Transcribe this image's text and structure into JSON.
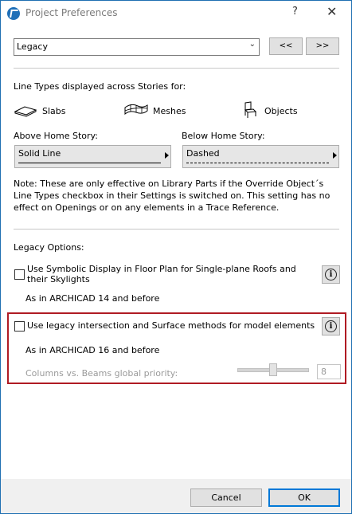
{
  "window": {
    "title": "Project Preferences",
    "help_glyph": "?",
    "close_glyph": "✕"
  },
  "prefs": {
    "selected": "Legacy",
    "prev_label": "<<",
    "next_label": ">>"
  },
  "linetypes": {
    "heading": "Line Types displayed across Stories for:",
    "items": [
      {
        "icon": "slab-icon",
        "label": "Slabs"
      },
      {
        "icon": "mesh-icon",
        "label": "Meshes"
      },
      {
        "icon": "chair-icon",
        "label": "Objects"
      }
    ],
    "above_label": "Above Home Story:",
    "above_value": "Solid Line",
    "below_label": "Below Home Story:",
    "below_value": "Dashed",
    "note": "Note: These are only effective on Library Parts if the Override Object´s Line Types checkbox in their Settings is switched on. This setting has no effect on Openings or on any elements in a Trace Reference."
  },
  "legacy": {
    "heading": "Legacy Options:",
    "opt1_label": "Use Symbolic Display in Floor Plan for Single-plane Roofs and their Skylights",
    "opt1_sub": "As in ARCHICAD 14 and before",
    "opt2_label": "Use legacy intersection and Surface methods for model elements",
    "opt2_sub": "As in ARCHICAD 16 and before",
    "priority_label": "Columns vs. Beams global priority:",
    "priority_value": "8",
    "info_glyph": "i"
  },
  "footer": {
    "cancel_label": "Cancel",
    "ok_label": "OK"
  },
  "colors": {
    "highlight_box": "#b01b23",
    "ok_border": "#0078d7"
  }
}
